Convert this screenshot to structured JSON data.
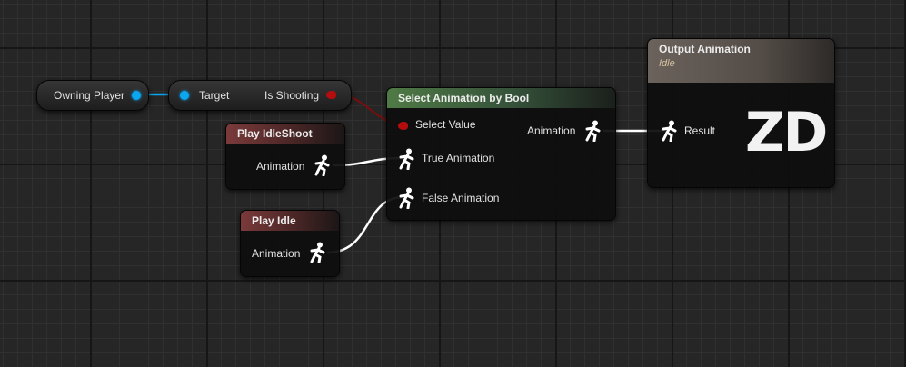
{
  "variable_node": {
    "pin_label": "Owning Player"
  },
  "is_shooting_node": {
    "input_label": "Target",
    "output_label": "Is Shooting"
  },
  "play_idleshoot_node": {
    "title": "Play IdleShoot",
    "output_label": "Animation"
  },
  "play_idle_node": {
    "title": "Play Idle",
    "output_label": "Animation"
  },
  "select_node": {
    "title": "Select Animation by Bool",
    "select_value_label": "Select Value",
    "true_label": "True Animation",
    "false_label": "False Animation",
    "output_label": "Animation"
  },
  "output_node": {
    "title": "Output Animation",
    "subtitle": "Idle",
    "input_label": "Result",
    "logo_text": "ZD"
  },
  "colors": {
    "object_pin": "#0aa6f0",
    "bool_pin": "#b30d0d",
    "exec_wire": "#ffffff",
    "header_red": "#7a3a3a",
    "header_green": "#4f7a45"
  },
  "icons": {
    "animation_pin": "running-figure-icon"
  }
}
